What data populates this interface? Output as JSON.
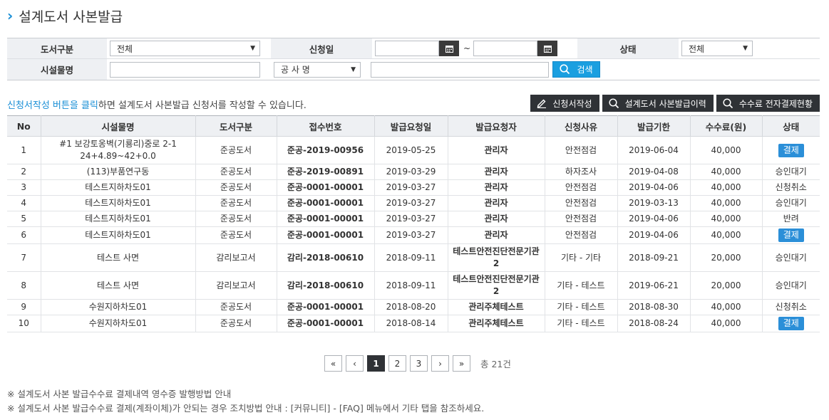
{
  "page": {
    "title": "설계도서 사본발급"
  },
  "search": {
    "book_type_label": "도서구분",
    "book_type_value": "전체",
    "request_date_label": "신청일",
    "date_separator": "~",
    "status_label": "상태",
    "status_value": "전체",
    "facility_label": "시설물명",
    "project_select_value": "공 사 명",
    "search_button_label": "검색"
  },
  "info": {
    "highlight": "신청서작성 버튼을 클릭",
    "rest": "하면 설계도서 사본발급 신청서를 작성할 수 있습니다."
  },
  "actions": {
    "write_label": "신청서작성",
    "history_label": "설계도서 사본발급이력",
    "fee_label": "수수료 전자결제현황"
  },
  "table": {
    "columns": [
      "No",
      "시설물명",
      "도서구분",
      "접수번호",
      "발급요청일",
      "발급요청자",
      "신청사유",
      "발급기한",
      "수수료(원)",
      "상태"
    ],
    "rows": [
      {
        "no": "1",
        "facility": "#1 보강토옹벽(기룡리)중로 2-1 24+4.89~42+0.0",
        "type": "준공도서",
        "receipt": "준공-2019-00956",
        "req_date": "2019-05-25",
        "requester": "관리자",
        "reason": "안전점검",
        "deadline": "2019-06-04",
        "fee": "40,000",
        "status": "결제",
        "status_button": true
      },
      {
        "no": "2",
        "facility": "(113)부품연구동",
        "type": "준공도서",
        "receipt": "준공-2019-00891",
        "req_date": "2019-03-29",
        "requester": "관리자",
        "reason": "하자조사",
        "deadline": "2019-04-08",
        "fee": "40,000",
        "status": "승인대기",
        "status_button": false
      },
      {
        "no": "3",
        "facility": "테스트지하차도01",
        "type": "준공도서",
        "receipt": "준공-0001-00001",
        "req_date": "2019-03-27",
        "requester": "관리자",
        "reason": "안전점검",
        "deadline": "2019-04-06",
        "fee": "40,000",
        "status": "신청취소",
        "status_button": false
      },
      {
        "no": "4",
        "facility": "테스트지하차도01",
        "type": "준공도서",
        "receipt": "준공-0001-00001",
        "req_date": "2019-03-27",
        "requester": "관리자",
        "reason": "안전점검",
        "deadline": "2019-03-13",
        "fee": "40,000",
        "status": "승인대기",
        "status_button": false
      },
      {
        "no": "5",
        "facility": "테스트지하차도01",
        "type": "준공도서",
        "receipt": "준공-0001-00001",
        "req_date": "2019-03-27",
        "requester": "관리자",
        "reason": "안전점검",
        "deadline": "2019-04-06",
        "fee": "40,000",
        "status": "반려",
        "status_button": false
      },
      {
        "no": "6",
        "facility": "테스트지하차도01",
        "type": "준공도서",
        "receipt": "준공-0001-00001",
        "req_date": "2019-03-27",
        "requester": "관리자",
        "reason": "안전점검",
        "deadline": "2019-04-06",
        "fee": "40,000",
        "status": "결제",
        "status_button": true
      },
      {
        "no": "7",
        "facility": "테스트 사면",
        "type": "감리보고서",
        "receipt": "감리-2018-00610",
        "req_date": "2018-09-11",
        "requester": "테스트안전진단전문기관2",
        "reason": "기타 - 기타",
        "deadline": "2018-09-21",
        "fee": "20,000",
        "status": "승인대기",
        "status_button": false
      },
      {
        "no": "8",
        "facility": "테스트 사면",
        "type": "감리보고서",
        "receipt": "감리-2018-00610",
        "req_date": "2018-09-11",
        "requester": "테스트안전진단전문기관2",
        "reason": "기타 - 테스트",
        "deadline": "2019-06-21",
        "fee": "20,000",
        "status": "승인대기",
        "status_button": false
      },
      {
        "no": "9",
        "facility": "수원지하차도01",
        "type": "준공도서",
        "receipt": "준공-0001-00001",
        "req_date": "2018-08-20",
        "requester": "관리주체테스트",
        "reason": "기타 - 테스트",
        "deadline": "2018-08-30",
        "fee": "40,000",
        "status": "신청취소",
        "status_button": false
      },
      {
        "no": "10",
        "facility": "수원지하차도01",
        "type": "준공도서",
        "receipt": "준공-0001-00001",
        "req_date": "2018-08-14",
        "requester": "관리주체테스트",
        "reason": "기타 - 테스트",
        "deadline": "2018-08-24",
        "fee": "40,000",
        "status": "결제",
        "status_button": true
      }
    ]
  },
  "pagination": {
    "first": "«",
    "prev": "‹",
    "pages": [
      "1",
      "2",
      "3"
    ],
    "current": "1",
    "next": "›",
    "last": "»",
    "total": "총 21건"
  },
  "notes": [
    "※ 설계도서 사본 발급수수료 결제내역 영수증 발행방법 안내",
    "※ 설계도서 사본 발급수수료 결제(계좌이체)가 안되는 경우 조치방법 안내 : [커뮤니티] - [FAQ] 메뉴에서 기타 탭을 참조하세요."
  ],
  "icons": {
    "title_chevron": "chevron-right-icon",
    "calendar": "calendar-icon",
    "search": "search-icon",
    "pencil": "pencil-icon"
  },
  "colors": {
    "accent": "#1a8fd6",
    "dark_button": "#2f3236",
    "pay_button": "#2b8fd8"
  }
}
